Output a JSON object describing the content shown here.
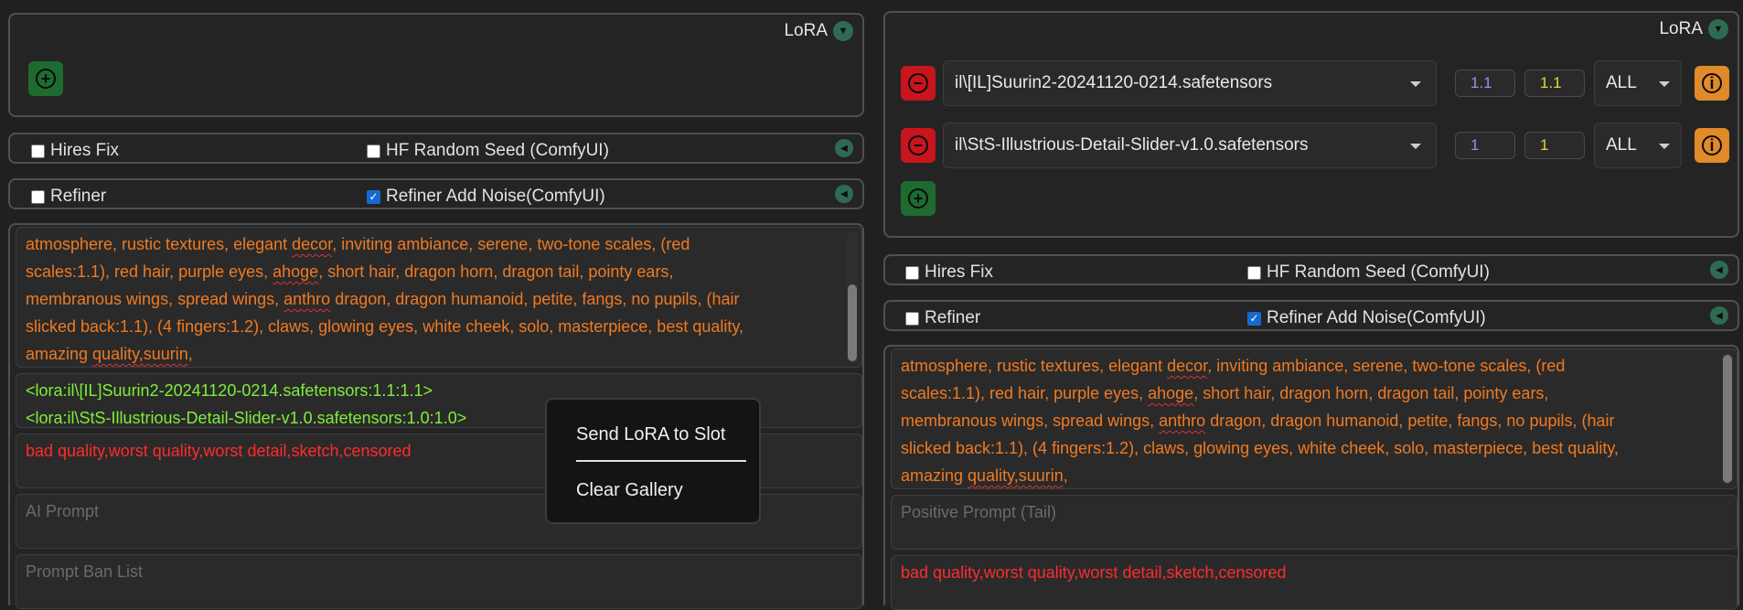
{
  "left": {
    "lora": {
      "title": "LoRA"
    },
    "hires": {
      "label": "Hires Fix",
      "checked": false,
      "seed_label": "HF Random Seed (ComfyUI)",
      "seed_checked": false
    },
    "refiner": {
      "label": "Refiner",
      "checked": false,
      "noise_label": "Refiner Add Noise(ComfyUI)",
      "noise_checked": true
    },
    "positive_prompt": {
      "lines": [
        [
          "atmosphere, rustic textures, elegant ",
          "decor",
          ", inviting ambiance, serene, two-tone scales, (red"
        ],
        [
          "scales:1.1), red hair, purple eyes, ",
          "ahoge",
          ", short hair, dragon horn, dragon tail, pointy ears,"
        ],
        [
          "membranous wings, spread wings, ",
          "anthro",
          " dragon, dragon humanoid, petite, fangs, no pupils, (hair"
        ],
        [
          "slicked back:1.1), (4 fingers:1.2), claws,  glowing eyes, white cheek, solo, masterpiece, best quality,"
        ],
        [
          "amazing ",
          "quality,suurin",
          ","
        ]
      ]
    },
    "lora_prompt": {
      "line1": "<lora:il\\[IL]Suurin2-20241120-0214.safetensors:1.1:1.1>",
      "line2": "<lora:il\\StS-Illustrious-Detail-Slider-v1.0.safetensors:1.0:1.0>"
    },
    "negative_prompt": {
      "text": "bad quality,worst quality,worst detail,sketch,censored"
    },
    "ai_prompt": {
      "placeholder": "AI Prompt"
    },
    "ban_list": {
      "placeholder": "Prompt Ban List"
    }
  },
  "context_menu": {
    "send_label": "Send LoRA to Slot",
    "clear_label": "Clear Gallery"
  },
  "right": {
    "lora": {
      "title": "LoRA",
      "slots": [
        {
          "model": "il\\[IL]Suurin2-20241120-0214.safetensors",
          "weight_a": "1.1",
          "weight_b": "1.1",
          "block": "ALL"
        },
        {
          "model": "il\\StS-Illustrious-Detail-Slider-v1.0.safetensors",
          "weight_a": "1",
          "weight_b": "1",
          "block": "ALL"
        }
      ]
    },
    "hires": {
      "label": "Hires Fix",
      "checked": false,
      "seed_label": "HF Random Seed (ComfyUI)",
      "seed_checked": false
    },
    "refiner": {
      "label": "Refiner",
      "checked": false,
      "noise_label": "Refiner Add Noise(ComfyUI)",
      "noise_checked": true
    },
    "positive_prompt": {
      "lines": [
        [
          "atmosphere, rustic textures, elegant ",
          "decor",
          ", inviting ambiance, serene, two-tone scales, (red"
        ],
        [
          "scales:1.1), red hair, purple eyes, ",
          "ahoge",
          ", short hair, dragon horn, dragon tail, pointy ears,"
        ],
        [
          "membranous wings, spread wings, ",
          "anthro",
          " dragon, dragon humanoid, petite, fangs, no pupils, (hair"
        ],
        [
          "slicked back:1.1), (4 fingers:1.2), claws,  glowing eyes, white cheek, solo, masterpiece, best quality,"
        ],
        [
          "amazing ",
          "quality,suurin",
          ","
        ]
      ]
    },
    "positive_tail": {
      "placeholder": "Positive Prompt (Tail)"
    },
    "negative_prompt": {
      "text": "bad quality,worst quality,worst detail,sketch,censored"
    }
  },
  "colors": {
    "accent_green": "#2f6b52",
    "add_button": "#1e6b2f",
    "remove_button": "#c8151e",
    "info_button": "#e08a2a",
    "prompt_orange": "#f07a22",
    "lora_green": "#7fee3a",
    "negative_red": "#ff2b2b",
    "weight_a": "#9a8cf0",
    "weight_b": "#e8d23a"
  },
  "icons": {
    "add": "plus-circle-icon",
    "remove": "minus-circle-icon",
    "info": "info-circle-icon",
    "collapse": "triangle-chevron-icon",
    "dropdown": "caret-down-icon"
  }
}
